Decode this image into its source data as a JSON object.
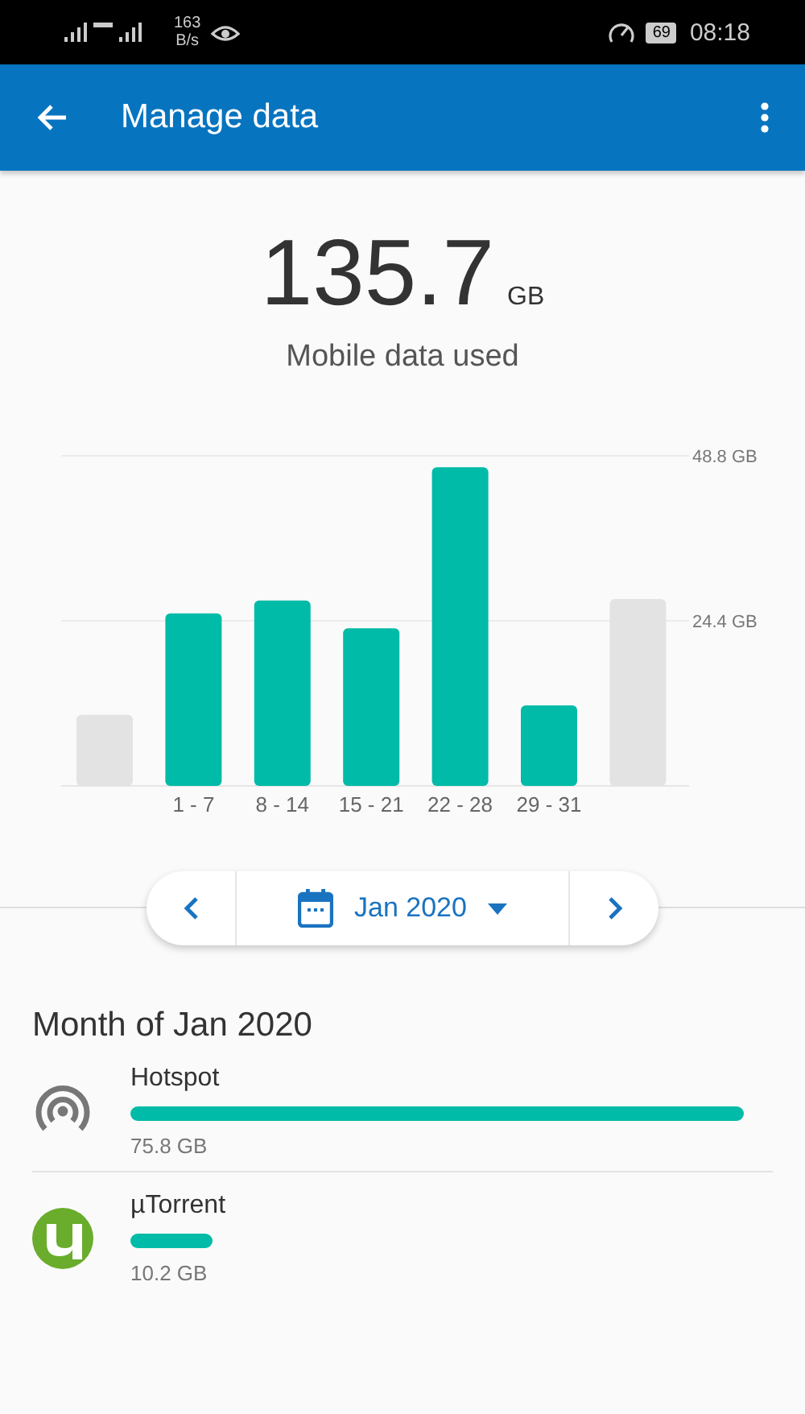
{
  "status_bar": {
    "speed_value": "163",
    "speed_unit": "B/s",
    "battery": "69",
    "time": "08:18"
  },
  "app_bar": {
    "title": "Manage data"
  },
  "summary": {
    "value": "135.7",
    "unit": "GB",
    "caption": "Mobile data used"
  },
  "chart_data": {
    "type": "bar",
    "categories": [
      null,
      "1 - 7",
      "8 - 14",
      "15 - 21",
      "22 - 28",
      "29 - 31",
      null
    ],
    "ylim": [
      0,
      48.8
    ],
    "yticks": [
      {
        "value": 24.4,
        "label": "24.4 GB"
      },
      {
        "value": 48.8,
        "label": "48.8 GB"
      }
    ],
    "series": [
      {
        "color": "#e3e3e3",
        "values": [
          10.5,
          null,
          null,
          null,
          null,
          null,
          27.6
        ]
      },
      {
        "color": "#00bba7",
        "values": [
          null,
          25.5,
          27.4,
          23.3,
          47.1,
          11.9,
          null
        ]
      }
    ]
  },
  "period": {
    "label": "Jan 2020"
  },
  "section_title": "Month of Jan 2020",
  "apps": [
    {
      "kind": "hotspot",
      "name": "Hotspot",
      "usage": "75.8 GB"
    },
    {
      "kind": "torrent",
      "name": "µTorrent",
      "usage": "10.2 GB"
    }
  ]
}
